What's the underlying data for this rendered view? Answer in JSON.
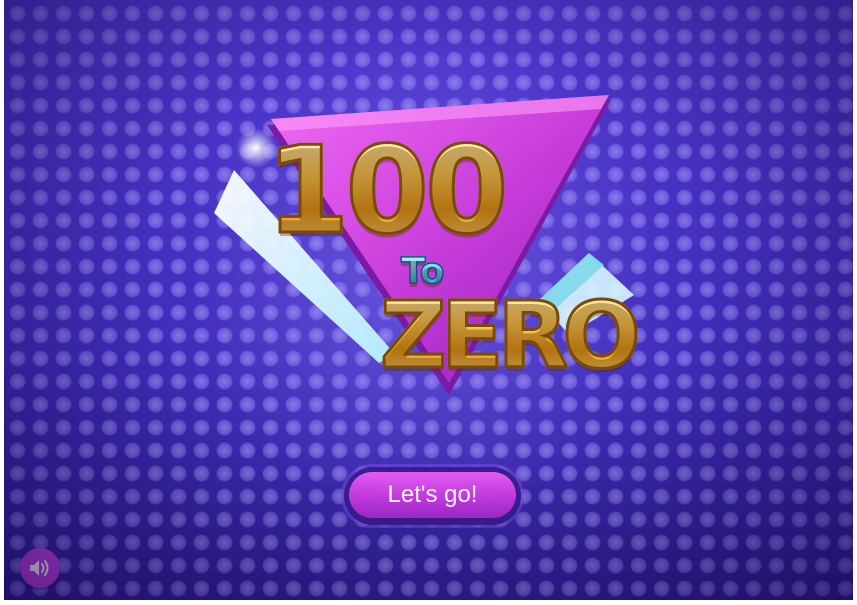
{
  "game": {
    "title_number": "100",
    "title_connector": "To",
    "title_word": "ZERO"
  },
  "actions": {
    "start_label": "Let's go!"
  },
  "icons": {
    "sound": "speaker-volume-icon"
  },
  "colors": {
    "background": "#3d2bb4",
    "button": "#c73be3",
    "sound_button": "#c13fe0",
    "logo_triangle": "#c43ad8",
    "title_gold": "#ffd35a",
    "title_blue": "#4fc6f5"
  }
}
